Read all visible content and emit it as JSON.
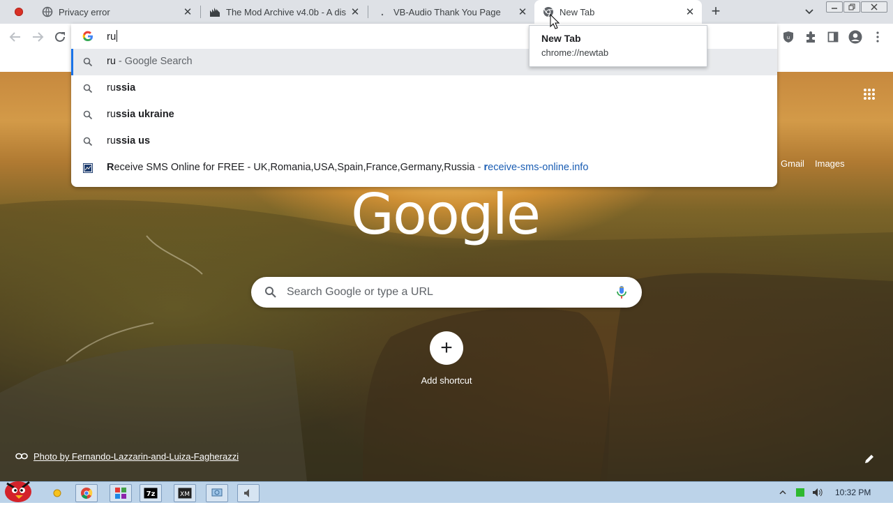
{
  "tabs": [
    {
      "title": "Privacy error",
      "icon": "globe-icon",
      "active": false
    },
    {
      "title": "The Mod Archive v4.0b - A dis",
      "icon": "mod-archive-icon",
      "active": false
    },
    {
      "title": "VB-Audio Thank You Page",
      "icon": "vb-audio-icon",
      "active": false
    },
    {
      "title": "New Tab",
      "icon": "chrome-icon",
      "active": true
    }
  ],
  "new_tab_symbol": "+",
  "tab_close_symbol": "✕",
  "omnibox": {
    "value": "ru",
    "suggestions": [
      {
        "bold": "ru",
        "rest": "",
        "suffix": " - Google Search",
        "icon": "search-icon",
        "selected": true
      },
      {
        "prefix": "ru",
        "bold": "ssia",
        "icon": "search-icon"
      },
      {
        "prefix": "ru",
        "bold": "ssia ukraine",
        "icon": "search-icon"
      },
      {
        "prefix": "ru",
        "bold": "ssia us",
        "icon": "search-icon"
      }
    ],
    "site_suggestion": {
      "bold": "R",
      "title": "eceive SMS Online for FREE - UK,Romania,USA,Spain,France,Germany,Russia",
      "sep": " - ",
      "url_bold": "r",
      "url": "eceive-sms-online.info",
      "icon": "site-favicon-icon"
    }
  },
  "tooltip": {
    "title": "New Tab",
    "url": "chrome://newtab"
  },
  "ntp": {
    "gmail": "Gmail",
    "images": "Images",
    "logo": "Google",
    "search_placeholder": "Search Google or type a URL",
    "add_shortcut": "Add shortcut",
    "attribution": "Photo by Fernando-Lazzarin-and-Luiza-Fagherazzi"
  },
  "taskbar": {
    "clock": "10:32 PM",
    "items": [
      "angry-birds-icon",
      "sun-icon",
      "chrome-icon",
      "rgb-app-icon",
      "7zip-icon",
      "xm-icon",
      "network-app-icon",
      "speaker-app-icon"
    ]
  },
  "colors": {
    "accent": "#1a73e8",
    "tabstrip": "#dee1e6",
    "taskbar": "#bcd3e9"
  }
}
